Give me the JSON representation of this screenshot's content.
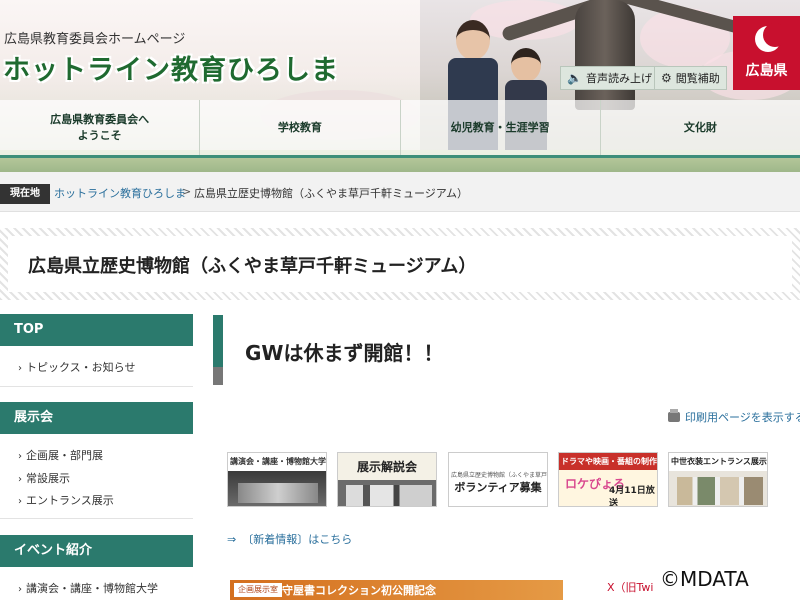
{
  "header": {
    "subtitle": "広島県教育委員会ホームページ",
    "title": "ホットライン教育ひろしま",
    "logo_text": "広島県",
    "tools": [
      {
        "label": "音声読み上げ",
        "icon": "speaker-icon"
      },
      {
        "label": "閲覧補助",
        "icon": "gear-icon"
      }
    ]
  },
  "nav": {
    "items": [
      "広島県教育委員会へ\nようこそ",
      "学校教育",
      "幼児教育・生涯学習",
      "文化財"
    ]
  },
  "breadcrumb": {
    "badge": "現在地",
    "home": "ホットライン教育ひろしま",
    "separator": ">",
    "current": "広島県立歴史博物館（ふくやま草戸千軒ミュージアム）"
  },
  "page": {
    "title": "広島県立歴史博物館（ふくやま草戸千軒ミュージアム）"
  },
  "sidebar": {
    "sections": [
      {
        "heading": "TOP",
        "links": [
          "トピックス・お知らせ"
        ]
      },
      {
        "heading": "展示会",
        "links": [
          "企画展・部門展",
          "常設展示",
          "エントランス展示"
        ]
      },
      {
        "heading": "イベント紹介",
        "links": [
          "講演会・講座・博物館大学"
        ]
      }
    ]
  },
  "main": {
    "heading": "GWは休まず開館！！",
    "print_label": "印刷用ページを表示する",
    "banners": [
      {
        "caption": "講演会・講座・博物館大学"
      },
      {
        "caption": "展示解説会"
      },
      {
        "caption": "広島県立歴史博物館（ふくやま草戸千軒ミュージアム）",
        "big": "ボランティア募集"
      },
      {
        "caption": "ドラマや映画・番組の制作・撮影に協力しています",
        "logo": "ロケぴょる",
        "date": "4月11日放送"
      },
      {
        "caption": "中世衣装エントランス展示"
      }
    ],
    "news_arrow": "⇒",
    "news_link": "〔新着情報〕はこちら",
    "promo_tag": "企画展示室",
    "promo_text": "守屋書コレクション初公開記念",
    "x_link": "X（旧Twi"
  },
  "watermark": "©MDATA",
  "colors": {
    "accent": "#2b7a6d",
    "title_green": "#1f6a30",
    "logo_red": "#c8102e",
    "link_blue": "#2a6f9c"
  }
}
